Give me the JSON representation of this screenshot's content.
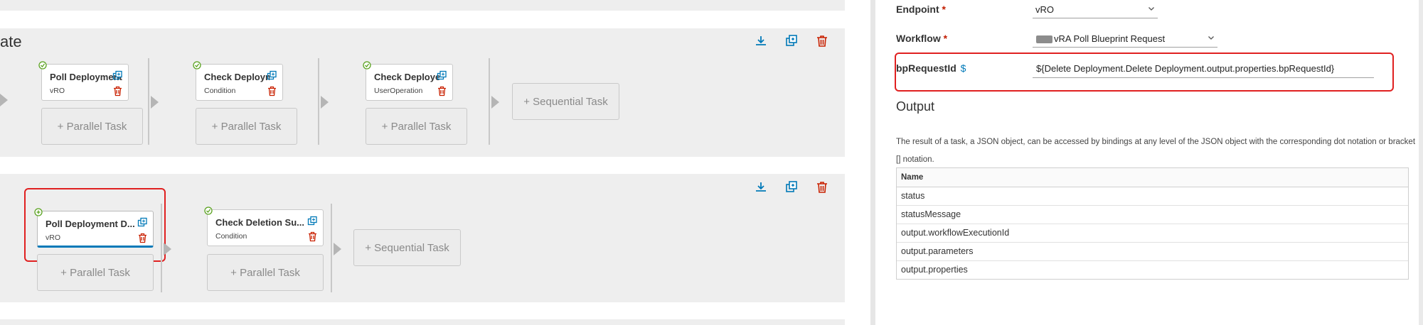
{
  "colors": {
    "accent": "#0079b8",
    "success": "#5aa220",
    "danger": "#c92100",
    "highlight_box": "#e02020"
  },
  "stage1": {
    "title_fragment": "ate",
    "tasks": [
      {
        "title": "Poll Deployment",
        "type": "vRO"
      },
      {
        "title": "Check Deploymen...",
        "type": "Condition"
      },
      {
        "title": "Check Deployed P...",
        "type": "UserOperation"
      }
    ],
    "parallel_label": "+ Parallel Task",
    "sequential_label": "+ Sequential Task"
  },
  "stage2": {
    "tasks": [
      {
        "title": "Poll Deployment D...",
        "type": "vRO"
      },
      {
        "title": "Check Deletion Su...",
        "type": "Condition"
      }
    ],
    "parallel_label": "+ Parallel Task",
    "sequential_label": "+ Sequential Task"
  },
  "panel": {
    "endpoint": {
      "label": "Endpoint",
      "required": "*",
      "value": "vRO"
    },
    "workflow": {
      "label": "Workflow",
      "required": "*",
      "value": "vRA Poll Blueprint Request"
    },
    "bp_request": {
      "label": "bpRequestId",
      "binding_symbol": "$",
      "value": "${Delete Deployment.Delete Deployment.output.properties.bpRequestId}"
    },
    "output": {
      "heading": "Output",
      "description": "The result of a task, a JSON object, can be accessed by bindings at any level of the JSON object with the corresponding dot notation or bracket [] notation.",
      "table": {
        "header": "Name",
        "rows": [
          "status",
          "statusMessage",
          "output.workflowExecutionId",
          "output.parameters",
          "output.properties"
        ]
      }
    }
  }
}
